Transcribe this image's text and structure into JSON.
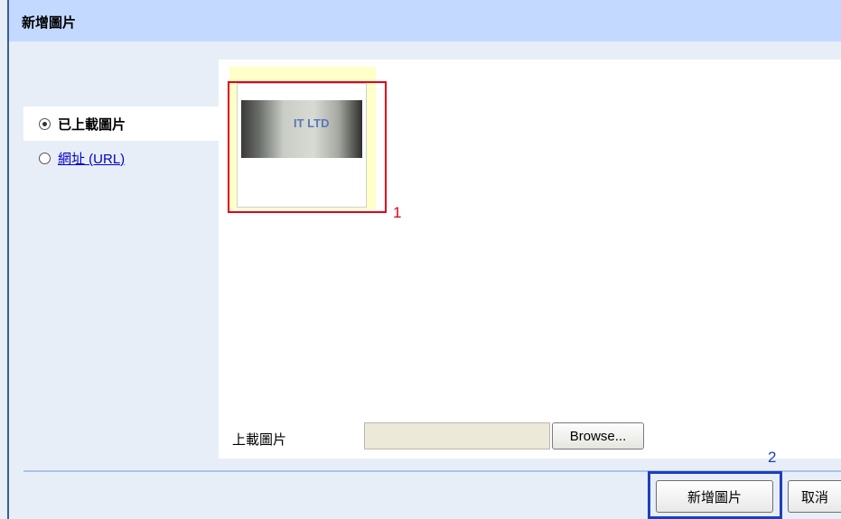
{
  "dialog": {
    "title": "新增圖片"
  },
  "sidebar": {
    "options": [
      {
        "label": "已上載圖片",
        "selected": true
      },
      {
        "label": "網址 (URL)",
        "selected": false
      }
    ]
  },
  "thumbnail": {
    "image_text": "IT LTD"
  },
  "upload": {
    "label": "上載圖片",
    "file_value": "",
    "browse_label": "Browse..."
  },
  "annotations": {
    "marker_1": "1",
    "marker_2": "2",
    "marker_1_color": "#e0001b",
    "marker_2_color": "#1d3fbf"
  },
  "footer": {
    "add_button_label": "新增圖片",
    "cancel_button_label": "取消"
  }
}
